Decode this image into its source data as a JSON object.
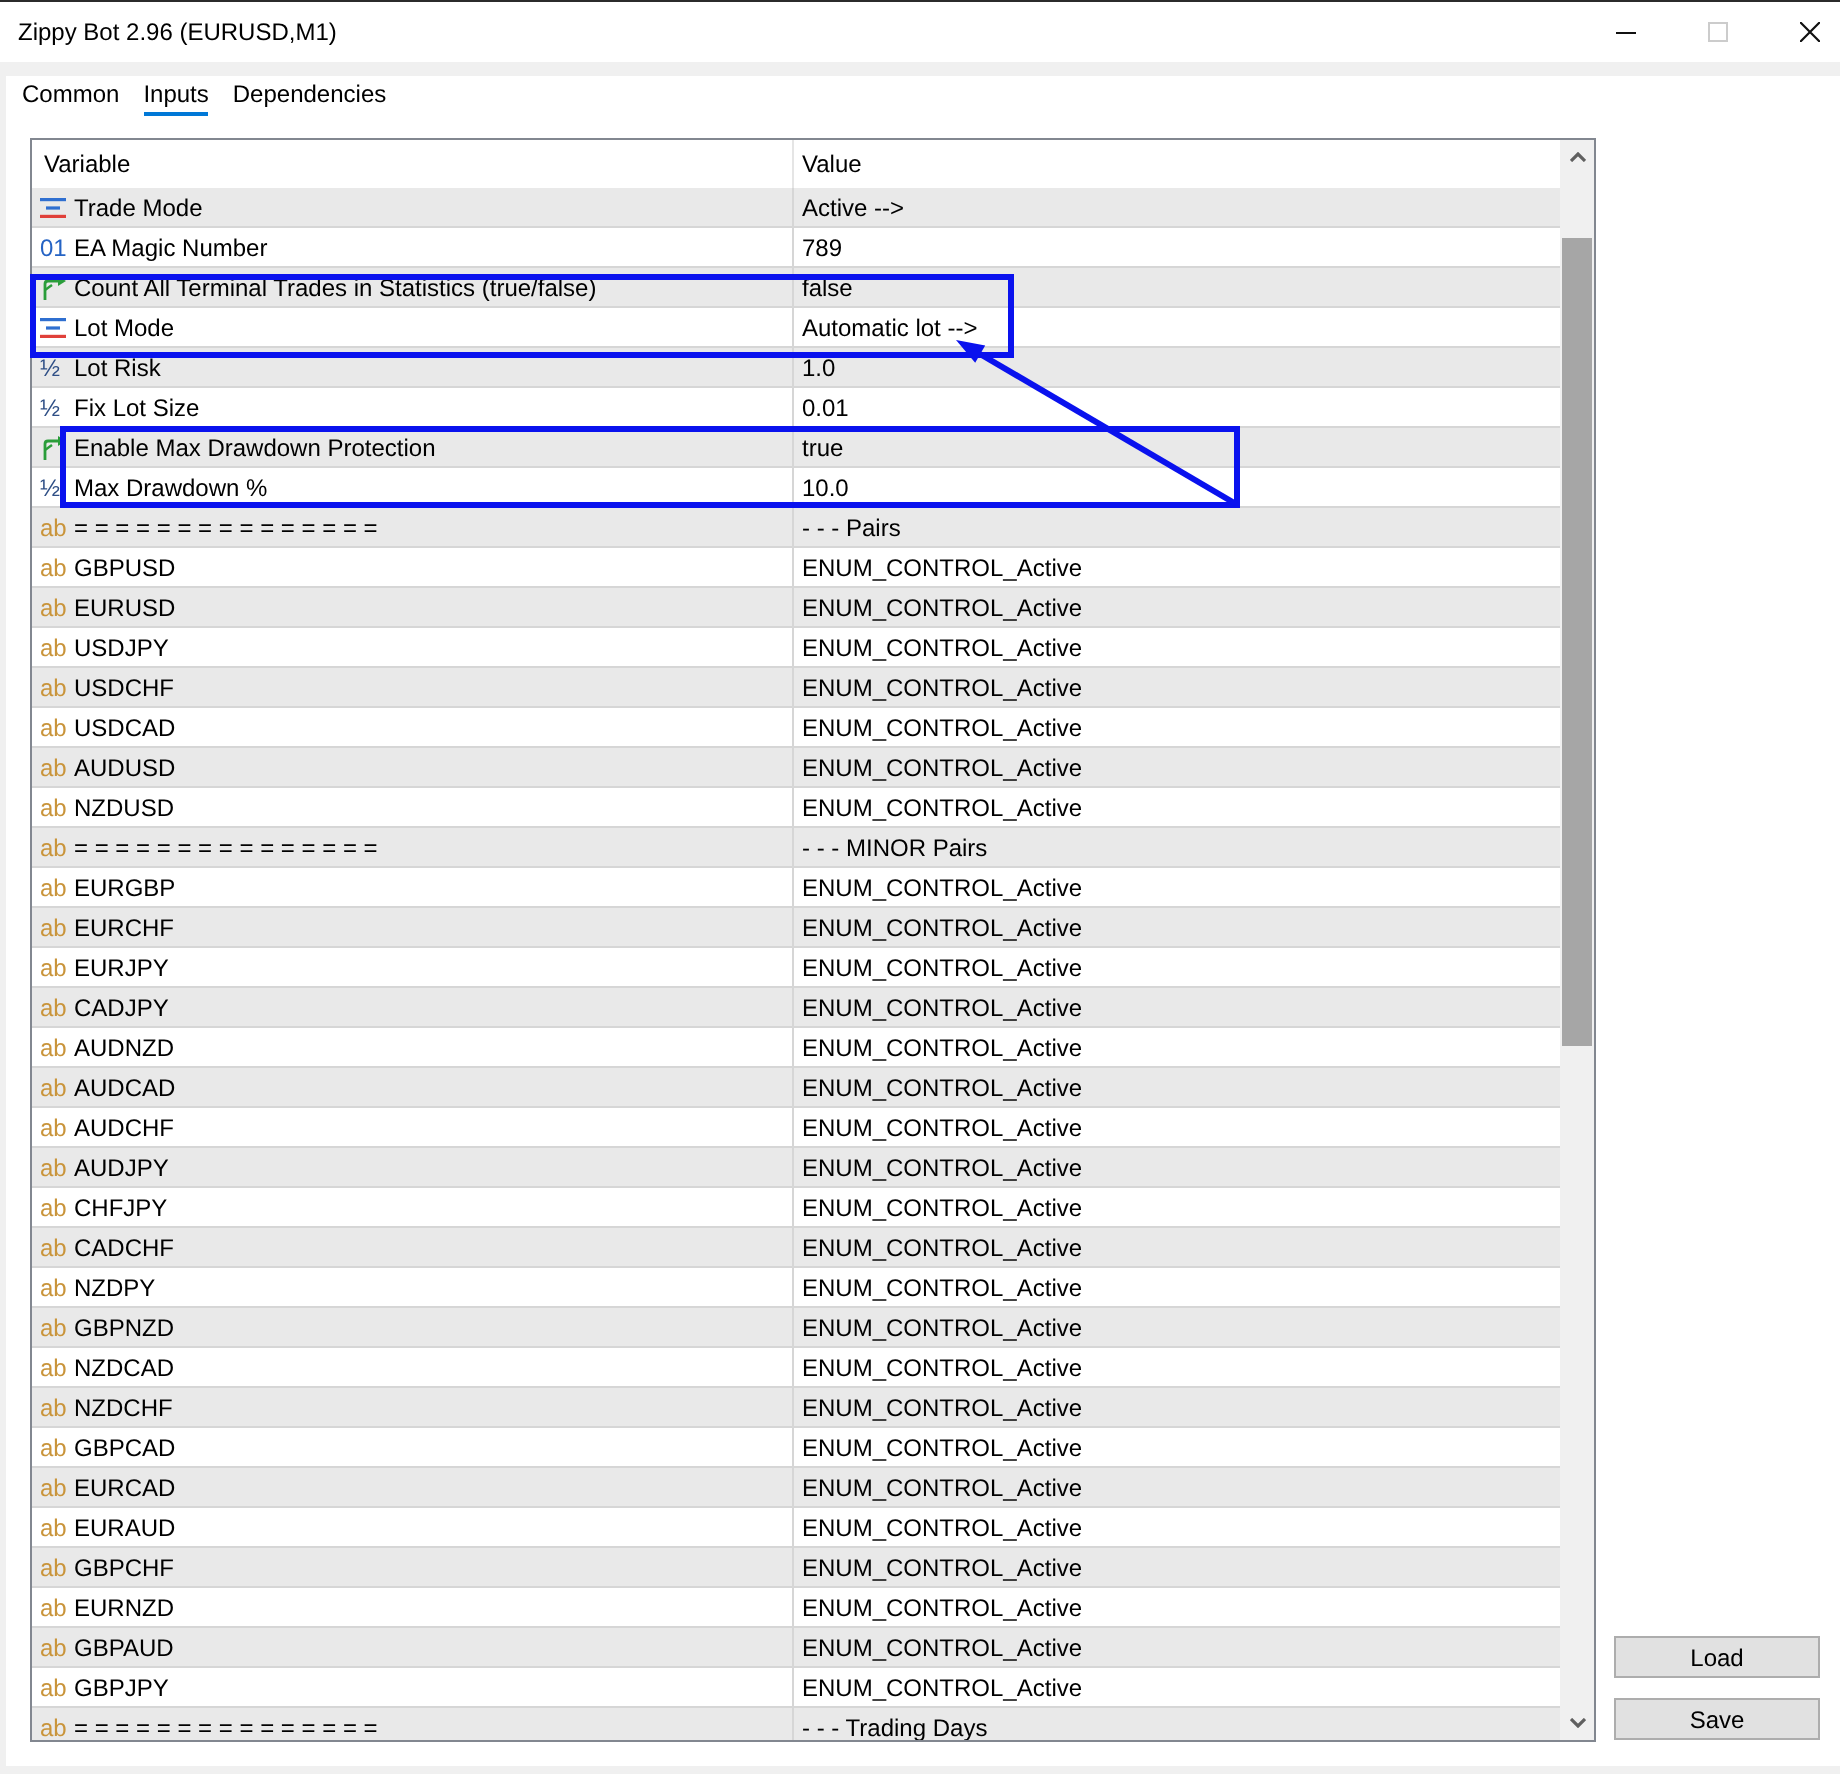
{
  "window": {
    "title": "Zippy Bot 2.96 (EURUSD,M1)",
    "controls": [
      {
        "kind": "minimize",
        "disabled": false
      },
      {
        "kind": "maximize",
        "disabled": true
      },
      {
        "kind": "close",
        "disabled": false
      }
    ]
  },
  "tabs": [
    {
      "label": "Common",
      "selected": false
    },
    {
      "label": "Inputs",
      "selected": true
    },
    {
      "label": "Dependencies",
      "selected": false
    }
  ],
  "table": {
    "columns": [
      "Variable",
      "Value"
    ],
    "rows": [
      {
        "kind": "enum",
        "variable": "Trade Mode",
        "value": "Active -->"
      },
      {
        "kind": "int",
        "icon_text": "01",
        "variable": "EA Magic Number",
        "value": "789"
      },
      {
        "kind": "bool",
        "variable": "Count All Terminal Trades in Statistics (true/false)",
        "value": "false"
      },
      {
        "kind": "enum",
        "variable": "Lot Mode",
        "value": "Automatic lot -->"
      },
      {
        "kind": "double",
        "icon_text": "½",
        "variable": "Lot Risk",
        "value": "1.0"
      },
      {
        "kind": "double",
        "icon_text": "½",
        "variable": "Fix Lot Size",
        "value": "0.01"
      },
      {
        "kind": "bool",
        "variable": "Enable Max Drawdown Protection",
        "value": "true"
      },
      {
        "kind": "double",
        "icon_text": "½",
        "variable": "Max Drawdown %",
        "value": "10.0"
      },
      {
        "kind": "string",
        "icon_text": "ab",
        "variable": "= = = = = = = = = = = = = = =",
        "value": "- - - Pairs"
      },
      {
        "kind": "string",
        "icon_text": "ab",
        "variable": "GBPUSD",
        "value": "ENUM_CONTROL_Active"
      },
      {
        "kind": "string",
        "icon_text": "ab",
        "variable": "EURUSD",
        "value": "ENUM_CONTROL_Active"
      },
      {
        "kind": "string",
        "icon_text": "ab",
        "variable": "USDJPY",
        "value": "ENUM_CONTROL_Active"
      },
      {
        "kind": "string",
        "icon_text": "ab",
        "variable": "USDCHF",
        "value": "ENUM_CONTROL_Active"
      },
      {
        "kind": "string",
        "icon_text": "ab",
        "variable": "USDCAD",
        "value": "ENUM_CONTROL_Active"
      },
      {
        "kind": "string",
        "icon_text": "ab",
        "variable": "AUDUSD",
        "value": "ENUM_CONTROL_Active"
      },
      {
        "kind": "string",
        "icon_text": "ab",
        "variable": "NZDUSD",
        "value": "ENUM_CONTROL_Active"
      },
      {
        "kind": "string",
        "icon_text": "ab",
        "variable": "= = = = = = = = = = = = = = =",
        "value": "- - - MINOR Pairs"
      },
      {
        "kind": "string",
        "icon_text": "ab",
        "variable": "EURGBP",
        "value": "ENUM_CONTROL_Active"
      },
      {
        "kind": "string",
        "icon_text": "ab",
        "variable": "EURCHF",
        "value": "ENUM_CONTROL_Active"
      },
      {
        "kind": "string",
        "icon_text": "ab",
        "variable": "EURJPY",
        "value": "ENUM_CONTROL_Active"
      },
      {
        "kind": "string",
        "icon_text": "ab",
        "variable": "CADJPY",
        "value": "ENUM_CONTROL_Active"
      },
      {
        "kind": "string",
        "icon_text": "ab",
        "variable": "AUDNZD",
        "value": "ENUM_CONTROL_Active"
      },
      {
        "kind": "string",
        "icon_text": "ab",
        "variable": "AUDCAD",
        "value": "ENUM_CONTROL_Active"
      },
      {
        "kind": "string",
        "icon_text": "ab",
        "variable": "AUDCHF",
        "value": "ENUM_CONTROL_Active"
      },
      {
        "kind": "string",
        "icon_text": "ab",
        "variable": "AUDJPY",
        "value": "ENUM_CONTROL_Active"
      },
      {
        "kind": "string",
        "icon_text": "ab",
        "variable": "CHFJPY",
        "value": "ENUM_CONTROL_Active"
      },
      {
        "kind": "string",
        "icon_text": "ab",
        "variable": "CADCHF",
        "value": "ENUM_CONTROL_Active"
      },
      {
        "kind": "string",
        "icon_text": "ab",
        "variable": "NZDPY",
        "value": "ENUM_CONTROL_Active"
      },
      {
        "kind": "string",
        "icon_text": "ab",
        "variable": "GBPNZD",
        "value": "ENUM_CONTROL_Active"
      },
      {
        "kind": "string",
        "icon_text": "ab",
        "variable": "NZDCAD",
        "value": "ENUM_CONTROL_Active"
      },
      {
        "kind": "string",
        "icon_text": "ab",
        "variable": "NZDCHF",
        "value": "ENUM_CONTROL_Active"
      },
      {
        "kind": "string",
        "icon_text": "ab",
        "variable": "GBPCAD",
        "value": "ENUM_CONTROL_Active"
      },
      {
        "kind": "string",
        "icon_text": "ab",
        "variable": "EURCAD",
        "value": "ENUM_CONTROL_Active"
      },
      {
        "kind": "string",
        "icon_text": "ab",
        "variable": "EURAUD",
        "value": "ENUM_CONTROL_Active"
      },
      {
        "kind": "string",
        "icon_text": "ab",
        "variable": "GBPCHF",
        "value": "ENUM_CONTROL_Active"
      },
      {
        "kind": "string",
        "icon_text": "ab",
        "variable": "EURNZD",
        "value": "ENUM_CONTROL_Active"
      },
      {
        "kind": "string",
        "icon_text": "ab",
        "variable": "GBPAUD",
        "value": "ENUM_CONTROL_Active"
      },
      {
        "kind": "string",
        "icon_text": "ab",
        "variable": "GBPJPY",
        "value": "ENUM_CONTROL_Active"
      },
      {
        "kind": "string",
        "icon_text": "ab",
        "variable": "= = = = = = = = = = = = = = =",
        "value": "- - - Trading Days"
      }
    ]
  },
  "buttons": [
    "Load",
    "Save"
  ],
  "annotations": [
    {
      "kind": "highlight-box"
    },
    {
      "kind": "highlight-box"
    },
    {
      "kind": "arrow"
    }
  ]
}
